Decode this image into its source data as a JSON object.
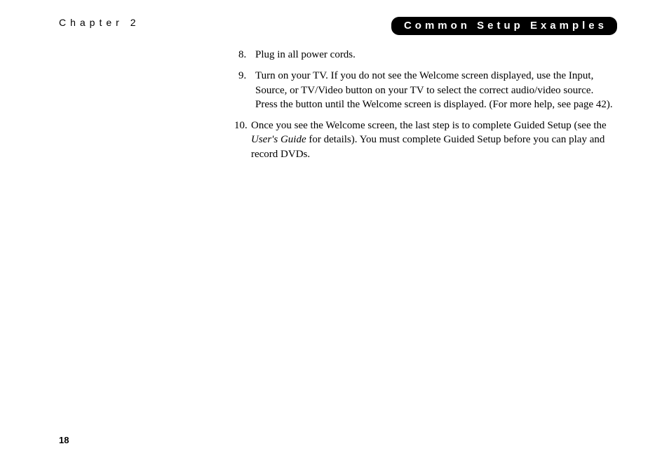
{
  "header": {
    "chapter": "Chapter 2",
    "section": "Common Setup Examples"
  },
  "items": [
    {
      "n": "8.",
      "text": "Plug in all power cords."
    },
    {
      "n": "9.",
      "text": "Turn on your TV. If you do not see the Welcome screen displayed, use the Input, Source, or TV/Video button on your TV to select the correct audio/video source. Press the button until the Welcome screen is displayed. (For more help, see page 42)."
    },
    {
      "n": "10.",
      "pre": "Once you see the Welcome screen, the last step is to complete Guided Setup (see the ",
      "italic": "User's Guide",
      "post": " for details). You must complete Guided Setup before you can play and record DVDs."
    }
  ],
  "page_number": "18"
}
